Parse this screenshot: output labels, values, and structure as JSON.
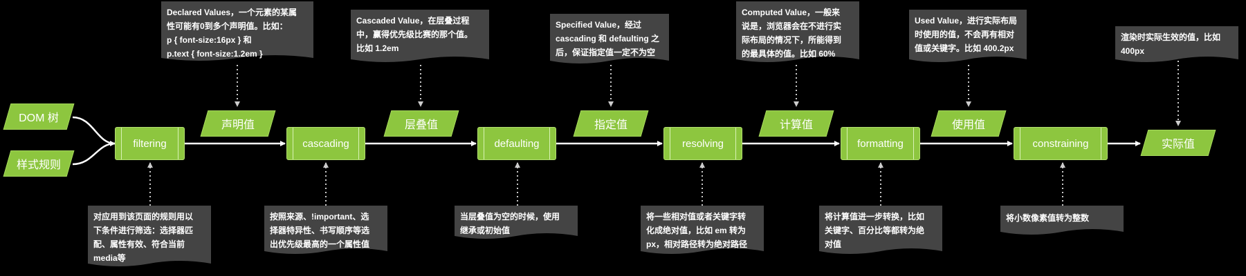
{
  "inputs": {
    "dom_tree": "DOM 树",
    "style_rules": "样式规则"
  },
  "steps": [
    {
      "name": "filtering"
    },
    {
      "name": "cascading"
    },
    {
      "name": "defaulting"
    },
    {
      "name": "resolving"
    },
    {
      "name": "formatting"
    },
    {
      "name": "constraining"
    }
  ],
  "values": [
    "声明值",
    "层叠值",
    "指定值",
    "计算值",
    "使用值",
    "实际值"
  ],
  "top_notes": [
    "Declared Values，一个元素的某属\n性可能有0到多个声明值。比如：\np { font-size:16px } 和\np.text { font-size:1.2em }",
    "Cascaded Value，在层叠过程\n中，赢得优先级比赛的那个值。\n比如 1.2em",
    "Specified Value，经过\ncascading 和 defaulting 之\n后，保证指定值一定不为空",
    "Computed Value，一般来\n说是，浏览器会在不进行实\n际布局的情况下，所能得到\n的最具体的值。比如 60%",
    "Used Value，进行实际布局\n时使用的值，不会再有相对\n值或关键字。比如 400.2px",
    "渲染时实际生效的值，比如\n400px"
  ],
  "bottom_notes": [
    "对应用到该页面的规则用以\n下条件进行筛选：选择器匹\n配、属性有效、符合当前\nmedia等",
    "按照来源、!important、选\n择器特异性、书写顺序等选\n出优先级最高的一个属性值",
    "当层叠值为空的时候，使用\n继承或初始值",
    "将一些相对值或者关键字转\n化成绝对值，比如 em 转为\npx，相对路径转为绝对路径",
    "将计算值进一步转换，比如\n关键字、百分比等都转为绝\n对值",
    "将小数像素值转为整数"
  ],
  "colors": {
    "shape_fill": "#8dc63f",
    "note_fill": "#444444",
    "line": "#ffffff",
    "dotted": "#bbbbbb"
  }
}
